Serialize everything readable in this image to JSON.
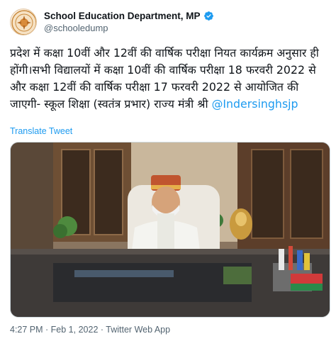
{
  "account": {
    "display_name": "School Education Department, MP",
    "handle": "@schooledump",
    "verified": true,
    "avatar_icon": "government-emblem-icon"
  },
  "tweet": {
    "text": "प्रदेश में कक्षा 10वीं और 12वीं की वार्षिक परीक्षा नियत कार्यक्रम अनुसार ही होंगी।सभी विद्यालयों में कक्षा 10वीं की वार्षिक परीक्षा 18 फरवरी 2022 से और कक्षा 12वीं की वार्षिक परीक्षा 17 फरवरी 2022 से आयोजित की जाएगी- स्कूल शिक्षा (स्वतंत्र प्रभार) राज्य मंत्री श्री ",
    "mention": "@Indersinghsjp",
    "translate_label": "Translate Tweet"
  },
  "meta": {
    "time": "4:27 PM",
    "separator": " · ",
    "date": "Feb 1, 2022",
    "source": "Twitter Web App"
  },
  "colors": {
    "link": "#1d9bf0",
    "secondary_text": "#536471",
    "verified_badge": "#1d9bf0"
  }
}
